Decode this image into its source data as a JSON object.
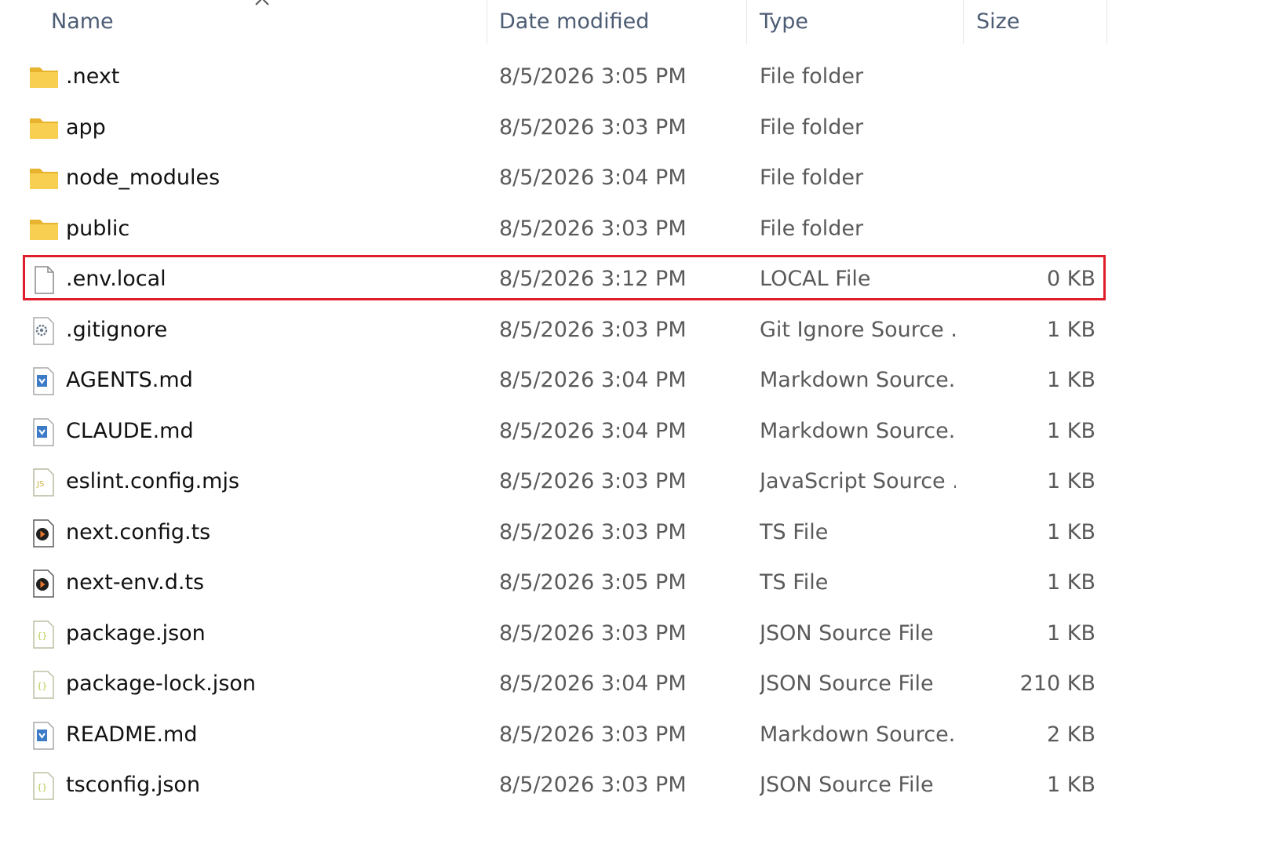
{
  "columns": {
    "name": "Name",
    "date": "Date modified",
    "type": "Type",
    "size": "Size"
  },
  "files": [
    {
      "icon": "folder-icon",
      "name": ".next",
      "date": "8/5/2026 3:05 PM",
      "type": "File folder",
      "size": ""
    },
    {
      "icon": "folder-icon",
      "name": "app",
      "date": "8/5/2026 3:03 PM",
      "type": "File folder",
      "size": ""
    },
    {
      "icon": "folder-icon",
      "name": "node_modules",
      "date": "8/5/2026 3:04 PM",
      "type": "File folder",
      "size": ""
    },
    {
      "icon": "folder-icon",
      "name": "public",
      "date": "8/5/2026 3:03 PM",
      "type": "File folder",
      "size": ""
    },
    {
      "icon": "blank-file-icon",
      "name": ".env.local",
      "date": "8/5/2026 3:12 PM",
      "type": "LOCAL File",
      "size": "0 KB",
      "highlighted": true
    },
    {
      "icon": "gear-file-icon",
      "name": ".gitignore",
      "date": "8/5/2026 3:03 PM",
      "type": "Git Ignore Source ...",
      "size": "1 KB"
    },
    {
      "icon": "markdown-file-icon",
      "name": "AGENTS.md",
      "date": "8/5/2026 3:04 PM",
      "type": "Markdown Source...",
      "size": "1 KB"
    },
    {
      "icon": "markdown-file-icon",
      "name": "CLAUDE.md",
      "date": "8/5/2026 3:04 PM",
      "type": "Markdown Source...",
      "size": "1 KB"
    },
    {
      "icon": "javascript-file-icon",
      "name": "eslint.config.mjs",
      "date": "8/5/2026 3:03 PM",
      "type": "JavaScript Source ...",
      "size": "1 KB"
    },
    {
      "icon": "typescript-file-icon",
      "name": "next.config.ts",
      "date": "8/5/2026 3:03 PM",
      "type": "TS File",
      "size": "1 KB"
    },
    {
      "icon": "typescript-file-icon",
      "name": "next-env.d.ts",
      "date": "8/5/2026 3:05 PM",
      "type": "TS File",
      "size": "1 KB"
    },
    {
      "icon": "json-file-icon",
      "name": "package.json",
      "date": "8/5/2026 3:03 PM",
      "type": "JSON Source File",
      "size": "1 KB"
    },
    {
      "icon": "json-file-icon",
      "name": "package-lock.json",
      "date": "8/5/2026 3:04 PM",
      "type": "JSON Source File",
      "size": "210 KB"
    },
    {
      "icon": "markdown-file-icon",
      "name": "README.md",
      "date": "8/5/2026 3:03 PM",
      "type": "Markdown Source...",
      "size": "2 KB"
    },
    {
      "icon": "json-file-icon",
      "name": "tsconfig.json",
      "date": "8/5/2026 3:03 PM",
      "type": "JSON Source File",
      "size": "1 KB"
    }
  ],
  "colors": {
    "highlight": "#e01e2a",
    "folder": "#f5c542",
    "header_text": "#4d5d74"
  }
}
